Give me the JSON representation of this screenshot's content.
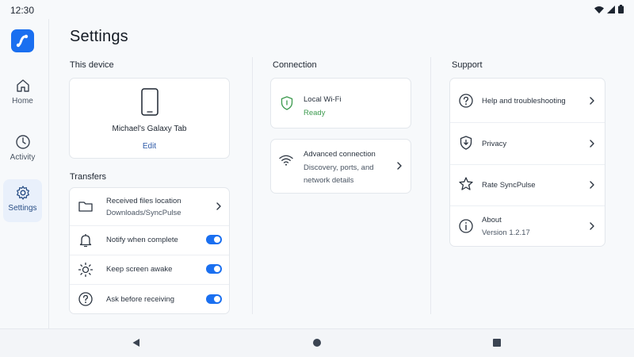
{
  "status_bar": {
    "time": "12:30",
    "icons": [
      "wifi-icon",
      "signal-icon",
      "battery-icon"
    ]
  },
  "nav": {
    "items": [
      {
        "id": "home",
        "label": "Home",
        "icon": "home-icon",
        "active": false
      },
      {
        "id": "activity",
        "label": "Activity",
        "icon": "clock-icon",
        "active": false
      },
      {
        "id": "settings",
        "label": "Settings",
        "icon": "gear-icon",
        "active": true
      }
    ]
  },
  "page": {
    "title": "Settings"
  },
  "this_device": {
    "section_title": "This device",
    "device_name": "Michael's Galaxy Tab",
    "edit_label": "Edit"
  },
  "transfers": {
    "section_title": "Transfers",
    "location": {
      "title": "Received files location",
      "value": "Downloads/SyncPulse"
    },
    "toggles": [
      {
        "label": "Notify when complete",
        "icon": "bell-icon",
        "on": true
      },
      {
        "label": "Keep screen awake",
        "icon": "sun-icon",
        "on": true
      },
      {
        "label": "Ask before receiving",
        "icon": "question-icon",
        "on": true
      }
    ]
  },
  "connection": {
    "section_title": "Connection",
    "local_wifi": {
      "title": "Local Wi-Fi",
      "status": "Ready"
    },
    "advanced": {
      "title": "Advanced connection",
      "line1": "Discovery, ports, and",
      "line2": "network details"
    }
  },
  "support": {
    "section_title": "Support",
    "items": [
      {
        "label": "Help and troubleshooting",
        "icon": "help-circle-icon"
      },
      {
        "label": "Privacy",
        "icon": "shield-download-icon"
      },
      {
        "label": "Rate SyncPulse",
        "icon": "star-icon"
      },
      {
        "label": "About",
        "sub": "Version 1.2.17",
        "icon": "info-icon"
      }
    ]
  },
  "colors": {
    "accent": "#1a6ff0",
    "ready": "#3c9a4e",
    "link": "#2e5aa8"
  }
}
